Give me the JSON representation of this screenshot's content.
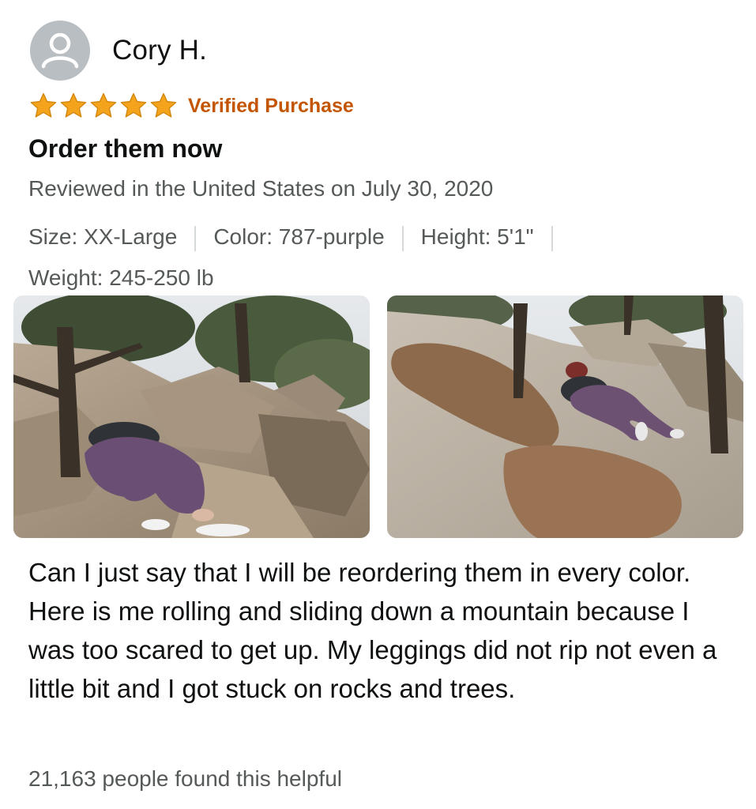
{
  "reviewer": {
    "name": "Cory H.",
    "avatar_icon": "default-user-icon"
  },
  "rating": {
    "stars": 5,
    "max": 5,
    "star_color": "#f4a41c",
    "verified_label": "Verified Purchase",
    "verified_color": "#c45500"
  },
  "review": {
    "title": "Order them now",
    "date_line": "Reviewed in the United States on July 30, 2020",
    "attributes": [
      "Size: XX-Large",
      "Color: 787-purple",
      "Height: 5'1\"",
      "Weight: 245-250 lb"
    ],
    "body": "Can I just say that I will be reordering them in every color. Here is me rolling and sliding down a mountain because I was too scared to get up. My leggings did not rip not even a little bit and I got stuck on rocks and trees.",
    "helpful_text": "21,163 people found this helpful"
  },
  "photos": [
    {
      "subject": "person-on-rocks-photo"
    },
    {
      "subject": "person-sliding-rock-photo"
    }
  ]
}
